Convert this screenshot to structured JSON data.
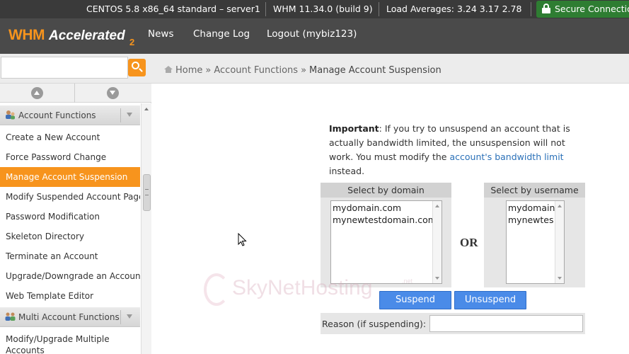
{
  "statusbar": {
    "os": "CENTOS 5.8 x86_64 standard – server1",
    "whm_version": "WHM 11.34.0 (build 9)",
    "load_averages": "Load Averages: 3.24 3.17 2.78",
    "secure": "Secure Connection"
  },
  "header": {
    "logo_whm": "WHM",
    "logo_accelerated": "Accelerated",
    "logo_version": "2",
    "nav": [
      "News",
      "Change Log",
      "Logout (mybiz123)"
    ]
  },
  "search": {
    "value": "",
    "placeholder": ""
  },
  "breadcrumb": {
    "home": "Home",
    "sep": "»",
    "section": "Account Functions",
    "current": "Manage Account Suspension"
  },
  "sidebar": {
    "category1": "Account Functions",
    "items": [
      "Create a New Account",
      "Force Password Change",
      "Manage Account Suspension",
      "Modify Suspended Account Page",
      "Password Modification",
      "Skeleton Directory",
      "Terminate an Account",
      "Upgrade/Downgrade an Account",
      "Web Template Editor"
    ],
    "category2": "Multi Account Functions",
    "items2": [
      "Modify/Upgrade Multiple",
      "Accounts"
    ]
  },
  "notice": {
    "bold": "Important",
    "text1": ": If you try to unsuspend an account that is actually bandwidth limited, the unsuspension will not work. You must modify the ",
    "link": "account's bandwidth limit",
    "text2": " instead."
  },
  "domain_select": {
    "header": "Select by domain",
    "options": [
      "mydomain.com",
      "mynewtestdomain.com"
    ]
  },
  "or_label": "OR",
  "username_select": {
    "header": "Select by username",
    "options": [
      "mydomain",
      "mynewtes"
    ]
  },
  "buttons": {
    "suspend": "Suspend",
    "unsuspend": "Unsuspend"
  },
  "reason": {
    "label": "Reason (if suspending):",
    "value": ""
  },
  "watermark": {
    "text": "SkyNetHosting",
    "suffix": ".net"
  }
}
